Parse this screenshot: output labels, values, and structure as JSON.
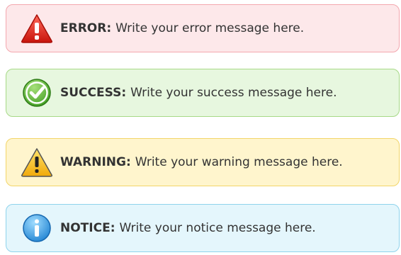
{
  "alerts": [
    {
      "type": "error",
      "icon": "error-triangle-icon",
      "label": "ERROR:",
      "message": "Write your error message here.",
      "background": "#fde8ea",
      "border": "#f3a7af"
    },
    {
      "type": "success",
      "icon": "check-circle-icon",
      "label": "SUCCESS:",
      "message": "Write your success message here.",
      "background": "#e7f7df",
      "border": "#a7d987"
    },
    {
      "type": "warning",
      "icon": "warning-triangle-icon",
      "label": "WARNING:",
      "message": "Write your warning message here.",
      "background": "#fff5cd",
      "border": "#f2d56a"
    },
    {
      "type": "notice",
      "icon": "info-circle-icon",
      "label": "NOTICE:",
      "message": "Write your notice message here.",
      "background": "#e4f6fc",
      "border": "#8fd3ec"
    }
  ]
}
